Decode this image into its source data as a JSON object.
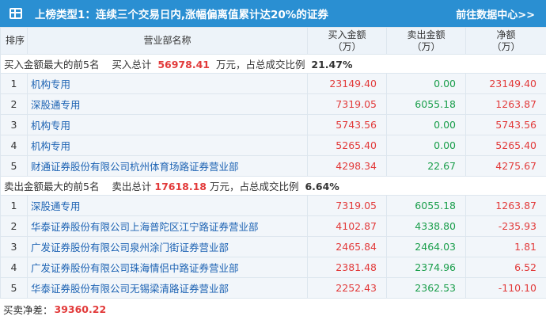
{
  "header": {
    "title": "上榜类型1：连续三个交易日内,涨幅偏离值累计达20%的证券",
    "link": "前往数据中心>>",
    "icon": "table-grid-icon"
  },
  "columns": {
    "idx": "排序",
    "name": "营业部名称",
    "buy": "买入金额（万）",
    "sell": "卖出金额（万）",
    "net": "净额（万）"
  },
  "buy_section": {
    "label": "买入金额最大的前5名",
    "total_prefix": "买入总计",
    "total_value": "56978.41",
    "total_suffix": "万元，占总成交比例",
    "ratio": "21.47%"
  },
  "buy_rows": [
    {
      "idx": "1",
      "name": "机构专用",
      "buy": "23149.40",
      "sell": "0.00",
      "net": "23149.40"
    },
    {
      "idx": "2",
      "name": "深股通专用",
      "buy": "7319.05",
      "sell": "6055.18",
      "net": "1263.87"
    },
    {
      "idx": "3",
      "name": "机构专用",
      "buy": "5743.56",
      "sell": "0.00",
      "net": "5743.56"
    },
    {
      "idx": "4",
      "name": "机构专用",
      "buy": "5265.40",
      "sell": "0.00",
      "net": "5265.40"
    },
    {
      "idx": "5",
      "name": "财通证券股份有限公司杭州体育场路证券营业部",
      "buy": "4298.34",
      "sell": "22.67",
      "net": "4275.67"
    }
  ],
  "sell_section": {
    "label": "卖出金额最大的前5名",
    "total_prefix": "卖出总计",
    "total_value": "17618.18",
    "total_suffix": "万元，占总成交比例",
    "ratio": "6.64%"
  },
  "sell_rows": [
    {
      "idx": "1",
      "name": "深股通专用",
      "buy": "7319.05",
      "sell": "6055.18",
      "net": "1263.87"
    },
    {
      "idx": "2",
      "name": "华泰证券股份有限公司上海普陀区江宁路证券营业部",
      "buy": "4102.87",
      "sell": "4338.80",
      "net": "-235.93"
    },
    {
      "idx": "3",
      "name": "广发证券股份有限公司泉州涂门街证券营业部",
      "buy": "2465.84",
      "sell": "2464.03",
      "net": "1.81"
    },
    {
      "idx": "4",
      "name": "广发证券股份有限公司珠海情侣中路证券营业部",
      "buy": "2381.48",
      "sell": "2374.96",
      "net": "6.52"
    },
    {
      "idx": "5",
      "name": "华泰证券股份有限公司无锡梁清路证券营业部",
      "buy": "2252.43",
      "sell": "2362.53",
      "net": "-110.10"
    }
  ],
  "footer": {
    "label": "买卖净差：",
    "value": "39360.22"
  },
  "colors": {
    "header_bg": "#2a8fd2",
    "buy": "#e23a3a",
    "sell": "#1a9e4b",
    "name_link": "#1d63b3"
  }
}
